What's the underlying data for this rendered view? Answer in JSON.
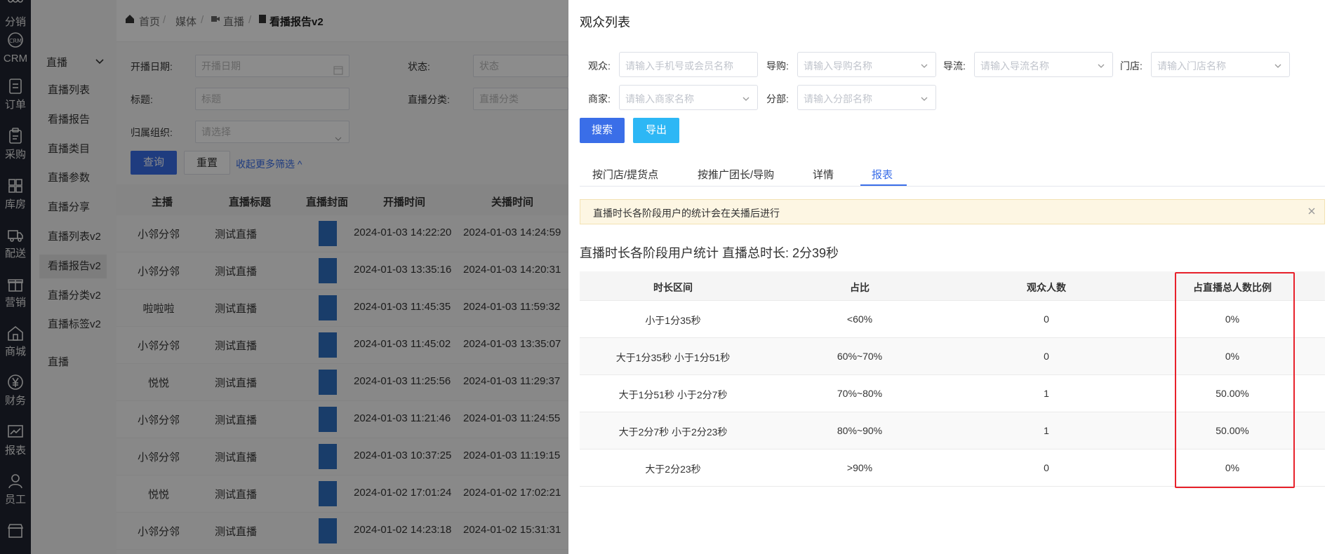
{
  "rail": [
    {
      "label": "分销",
      "icon": "share-icon"
    },
    {
      "label": "CRM",
      "icon": "crm-icon"
    },
    {
      "label": "订单",
      "icon": "order-icon"
    },
    {
      "label": "采购",
      "icon": "purchase-icon"
    },
    {
      "label": "库房",
      "icon": "warehouse-icon"
    },
    {
      "label": "配送",
      "icon": "truck-icon"
    },
    {
      "label": "营销",
      "icon": "gift-icon"
    },
    {
      "label": "商城",
      "icon": "home-icon"
    },
    {
      "label": "财务",
      "icon": "yen-icon"
    },
    {
      "label": "报表",
      "icon": "chart-icon"
    },
    {
      "label": "员工",
      "icon": "user-icon"
    },
    {
      "label": "",
      "icon": "store-icon"
    }
  ],
  "subnav": {
    "header": "直播",
    "items": [
      "直播列表",
      "看播报告",
      "直播类目",
      "直播参数",
      "直播分享",
      "直播列表v2",
      "看播报告v2",
      "直播分类v2",
      "直播标签v2",
      "直播"
    ]
  },
  "breadcrumb": [
    "首页",
    "媒体",
    "直播",
    "看播报告v2"
  ],
  "filters": {
    "start_date_label": "开播日期:",
    "start_date_ph": "开播日期",
    "status_label": "状态:",
    "status_ph": "状态",
    "title_label": "标题:",
    "title_ph": "标题",
    "category_label": "直播分类:",
    "category_ph": "直播分类",
    "org_label": "归属组织:",
    "org_ph": "请选择",
    "query": "查询",
    "reset": "重置",
    "collapse": "收起更多筛选"
  },
  "grid": {
    "headers": [
      "主播",
      "直播标题",
      "直播封面",
      "开播时间",
      "关播时间"
    ],
    "rows": [
      [
        "小邻分邻",
        "测试直播",
        "2024-01-03 14:22:20",
        "2024-01-03 14:24:59"
      ],
      [
        "小邻分邻",
        "测试直播",
        "2024-01-03 13:35:16",
        "2024-01-03 14:20:31"
      ],
      [
        "啦啦啦",
        "测试直播",
        "2024-01-03 11:45:35",
        "2024-01-03 11:59:32"
      ],
      [
        "小邻分邻",
        "测试直播",
        "2024-01-03 11:45:02",
        "2024-01-03 13:35:07"
      ],
      [
        "悦悦",
        "测试直播",
        "2024-01-03 11:25:56",
        "2024-01-03 11:29:37"
      ],
      [
        "小邻分邻",
        "测试直播",
        "2024-01-03 11:21:46",
        "2024-01-03 11:24:55"
      ],
      [
        "小邻分邻",
        "测试直播",
        "2024-01-03 10:37:25",
        "2024-01-03 11:19:15"
      ],
      [
        "悦悦",
        "测试直播",
        "2024-01-02 17:01:24",
        "2024-01-02 17:02:21"
      ],
      [
        "小邻分邻",
        "测试直播",
        "2024-01-02 14:23:18",
        "2024-01-02 15:31:31"
      ]
    ]
  },
  "drawer": {
    "title": "观众列表",
    "filters": {
      "viewer_label": "观众:",
      "viewer_ph": "请输入手机号或会员名称",
      "guide_label": "导购:",
      "guide_ph": "请输入导购名称",
      "flow_label": "导流:",
      "flow_ph": "请输入导流名称",
      "store_label": "门店:",
      "store_ph": "请输入门店名称",
      "merchant_label": "商家:",
      "merchant_ph": "请输入商家名称",
      "branch_label": "分部:",
      "branch_ph": "请输入分部名称"
    },
    "search": "搜索",
    "export": "导出",
    "tabs": [
      "按门店/提货点",
      "按推广团长/导购",
      "详情",
      "报表"
    ],
    "active_tab": 3,
    "notice": "直播时长各阶段用户的统计会在关播后进行",
    "stat_title": "直播时长各阶段用户统计 直播总时长:  2分39秒",
    "table": {
      "headers": [
        "时长区间",
        "占比",
        "观众人数",
        "占直播总人数比例"
      ],
      "rows": [
        [
          "小于1分35秒",
          "<60%",
          "0",
          "0%"
        ],
        [
          "大于1分35秒 小于1分51秒",
          "60%~70%",
          "0",
          "0%"
        ],
        [
          "大于1分51秒 小于2分7秒",
          "70%~80%",
          "1",
          "50.00%"
        ],
        [
          "大于2分7秒 小于2分23秒",
          "80%~90%",
          "1",
          "50.00%"
        ],
        [
          "大于2分23秒",
          ">90%",
          "0",
          "0%"
        ]
      ]
    }
  },
  "colors": {
    "primary": "#3a6ee8",
    "export": "#2db7f5",
    "highlight": "#e8212b",
    "rail_bg": "#1f2430"
  }
}
